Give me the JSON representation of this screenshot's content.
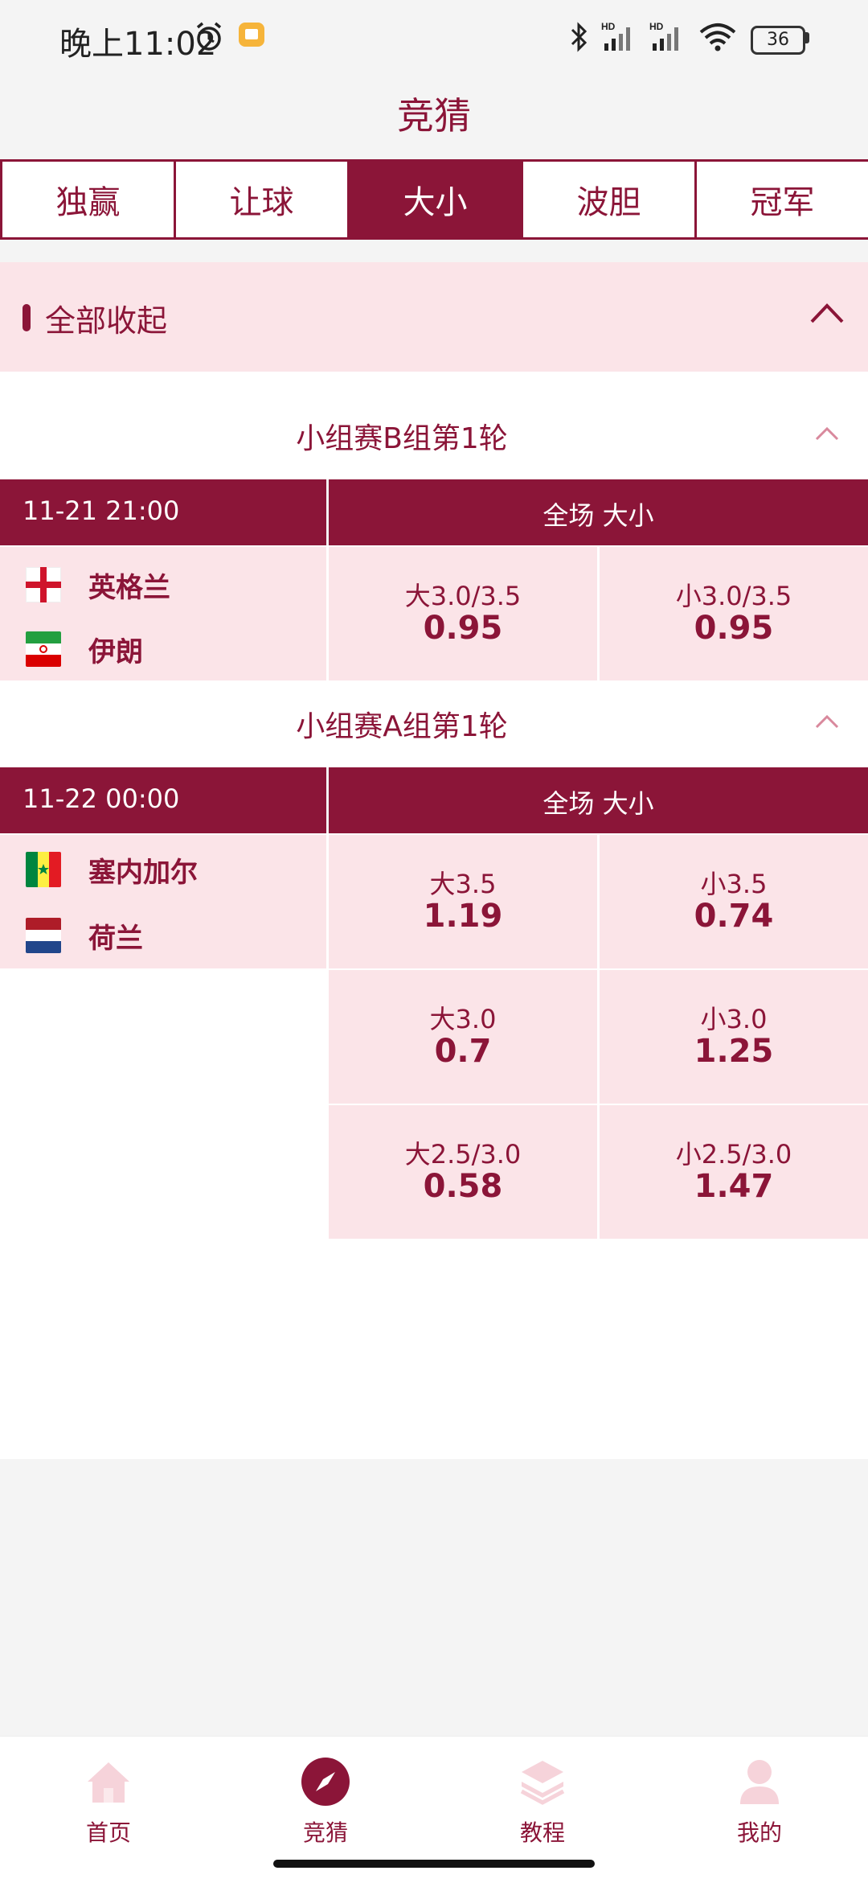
{
  "status_bar": {
    "time": "晚上11:02",
    "battery": "36"
  },
  "header": {
    "title": "竞猜"
  },
  "tabs": [
    {
      "label": "独赢",
      "active": false
    },
    {
      "label": "让球",
      "active": false
    },
    {
      "label": "大小",
      "active": true
    },
    {
      "label": "波胆",
      "active": false
    },
    {
      "label": "冠军",
      "active": false
    }
  ],
  "collapse_all": {
    "label": "全部收起"
  },
  "groups": [
    {
      "title": "小组赛B组第1轮",
      "match": {
        "time": "11-21 21:00",
        "market": "全场 大小",
        "teams": [
          {
            "name": "英格兰",
            "flag": "england"
          },
          {
            "name": "伊朗",
            "flag": "iran"
          }
        ],
        "odds_rows": [
          {
            "over_label": "大3.0/3.5",
            "over_value": "0.95",
            "under_label": "小3.0/3.5",
            "under_value": "0.95"
          }
        ]
      }
    },
    {
      "title": "小组赛A组第1轮",
      "match": {
        "time": "11-22 00:00",
        "market": "全场 大小",
        "teams": [
          {
            "name": "塞内加尔",
            "flag": "senegal"
          },
          {
            "name": "荷兰",
            "flag": "netherlands"
          }
        ],
        "odds_rows": [
          {
            "over_label": "大3.5",
            "over_value": "1.19",
            "under_label": "小3.5",
            "under_value": "0.74"
          },
          {
            "over_label": "大3.0",
            "over_value": "0.7",
            "under_label": "小3.0",
            "under_value": "1.25"
          },
          {
            "over_label": "大2.5/3.0",
            "over_value": "0.58",
            "under_label": "小2.5/3.0",
            "under_value": "1.47"
          }
        ]
      }
    }
  ],
  "bottom_nav": [
    {
      "label": "首页",
      "icon": "home-icon",
      "active": false
    },
    {
      "label": "竞猜",
      "icon": "compass-icon",
      "active": true
    },
    {
      "label": "教程",
      "icon": "layers-icon",
      "active": false
    },
    {
      "label": "我的",
      "icon": "user-icon",
      "active": false
    }
  ],
  "colors": {
    "brand": "#8b1538",
    "row_bg": "#fbe4e8",
    "inactive_icon": "#f6d3da"
  }
}
